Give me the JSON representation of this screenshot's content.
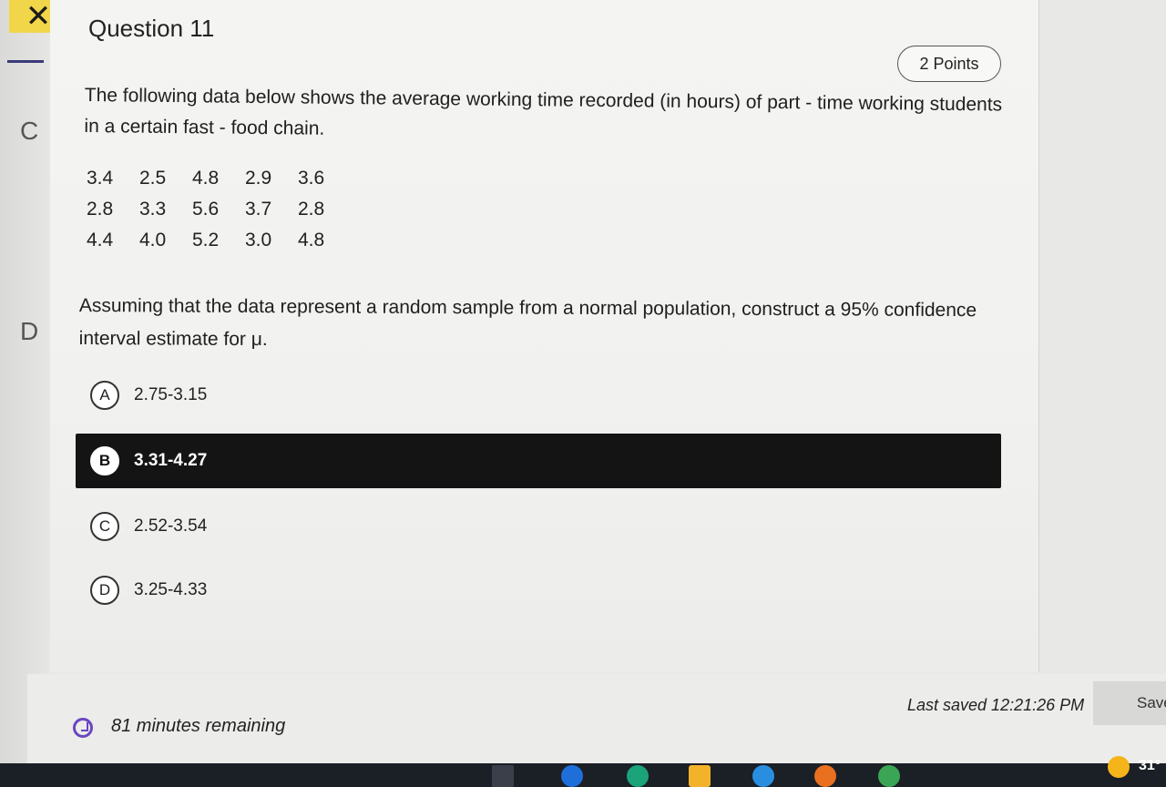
{
  "question": {
    "title": "Question 11",
    "points": "2 Points",
    "prompt": "The following data below shows the average working time recorded (in hours) of part - time working students in a certain fast - food chain.",
    "data_rows": [
      [
        "3.4",
        "2.5",
        "4.8",
        "2.9",
        "3.6"
      ],
      [
        "2.8",
        "3.3",
        "5.6",
        "3.7",
        "2.8"
      ],
      [
        "4.4",
        "4.0",
        "5.2",
        "3.0",
        "4.8"
      ]
    ],
    "assumption": "Assuming that the data represent a random sample from a normal population, construct a 95% confidence interval estimate for μ."
  },
  "options": [
    {
      "letter": "A",
      "text": "2.75-3.15",
      "selected": false
    },
    {
      "letter": "B",
      "text": "3.31-4.27",
      "selected": true
    },
    {
      "letter": "C",
      "text": "2.52-3.54",
      "selected": false
    },
    {
      "letter": "D",
      "text": "3.25-4.33",
      "selected": false
    }
  ],
  "footer": {
    "timer": "81 minutes remaining",
    "last_saved": "Last saved 12:21:26 PM",
    "save_label": "Save"
  },
  "sidebar": {
    "letters": [
      "C",
      "D"
    ]
  },
  "taskbar": {
    "temperature": "31°"
  },
  "colors": {
    "close_tab": "#f2d64a",
    "selected_option": "#141414",
    "timer_icon": "#6b46c1"
  }
}
